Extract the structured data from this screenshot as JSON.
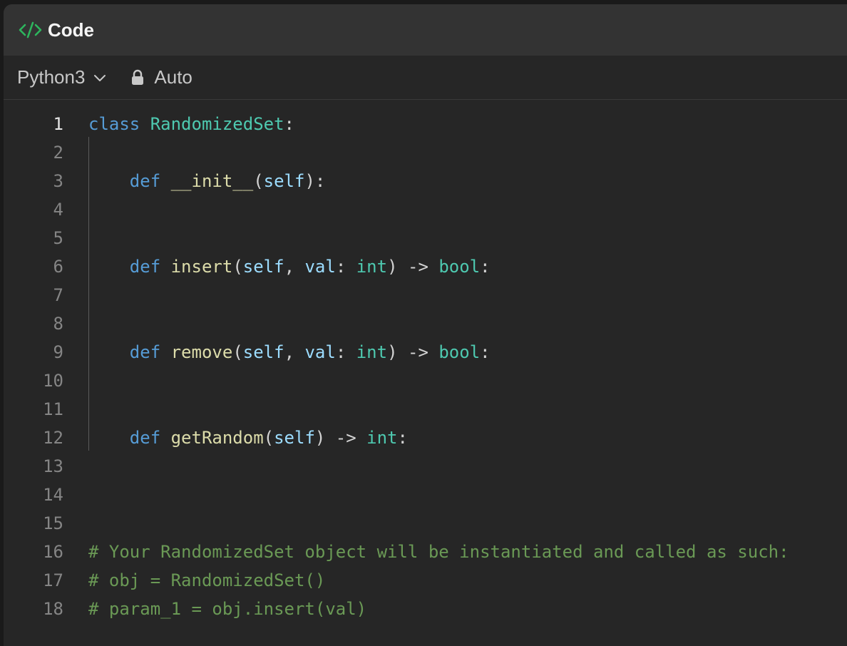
{
  "window": {
    "title": "Code",
    "accent_color": "#2db55d"
  },
  "toolbar": {
    "language": "Python3",
    "mode": "Auto"
  },
  "editor": {
    "line_numbers": [
      "1",
      "2",
      "3",
      "4",
      "5",
      "6",
      "7",
      "8",
      "9",
      "10",
      "11",
      "12",
      "13",
      "14",
      "15",
      "16",
      "17",
      "18"
    ],
    "line1": {
      "kw": "class",
      "sp": " ",
      "cls": "RandomizedSet",
      "pun": ":"
    },
    "line3": {
      "indent": "    ",
      "kw": "def",
      "sp": " ",
      "fn": "__init__",
      "p1": "(",
      "self": "self",
      "p2": "):"
    },
    "line6": {
      "indent": "    ",
      "kw": "def",
      "sp": " ",
      "fn": "insert",
      "p1": "(",
      "self": "self",
      "p2": ", ",
      "param": "val",
      "p3": ": ",
      "t1": "int",
      "p4": ") -> ",
      "t2": "bool",
      "p5": ":"
    },
    "line9": {
      "indent": "    ",
      "kw": "def",
      "sp": " ",
      "fn": "remove",
      "p1": "(",
      "self": "self",
      "p2": ", ",
      "param": "val",
      "p3": ": ",
      "t1": "int",
      "p4": ") -> ",
      "t2": "bool",
      "p5": ":"
    },
    "line12": {
      "indent": "    ",
      "kw": "def",
      "sp": " ",
      "fn": "getRandom",
      "p1": "(",
      "self": "self",
      "p2": ") -> ",
      "t1": "int",
      "p3": ":"
    },
    "line16": "# Your RandomizedSet object will be instantiated and called as such:",
    "line17": "# obj = RandomizedSet()",
    "line18": "# param_1 = obj.insert(val)"
  }
}
